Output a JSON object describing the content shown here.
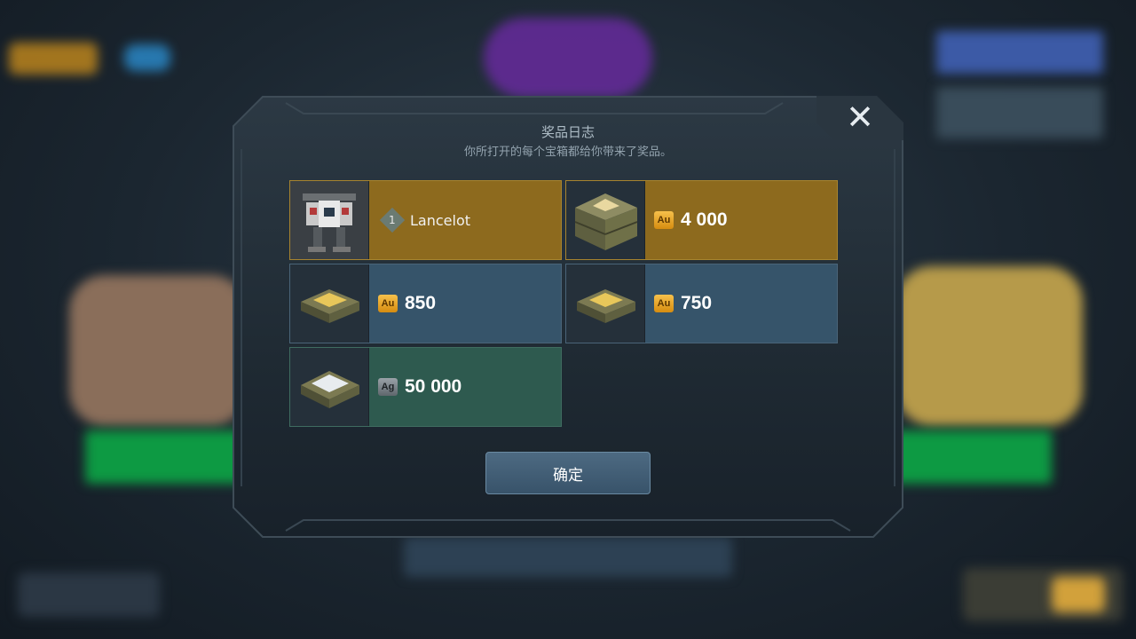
{
  "dialog": {
    "title": "奖品日志",
    "subtitle": "你所打开的每个宝箱都给你带来了奖品。",
    "confirm_label": "确定"
  },
  "rewards": [
    {
      "kind": "robot",
      "name": "Lancelot",
      "level": "1",
      "color": "#8d6a1e"
    },
    {
      "kind": "gold",
      "currency": "Au",
      "amount": "4 000",
      "color": "#8d6a1e"
    },
    {
      "kind": "gold",
      "currency": "Au",
      "amount": "850",
      "color": "#36546a"
    },
    {
      "kind": "gold",
      "currency": "Au",
      "amount": "750",
      "color": "#36546a"
    },
    {
      "kind": "silver",
      "currency": "Ag",
      "amount": "50 000",
      "color": "#2e5a4f"
    }
  ],
  "icons": {
    "close": "close-icon",
    "robot": "robot-icon",
    "crate": "crate-icon",
    "gold": "gold-currency-icon",
    "silver": "silver-currency-icon"
  }
}
